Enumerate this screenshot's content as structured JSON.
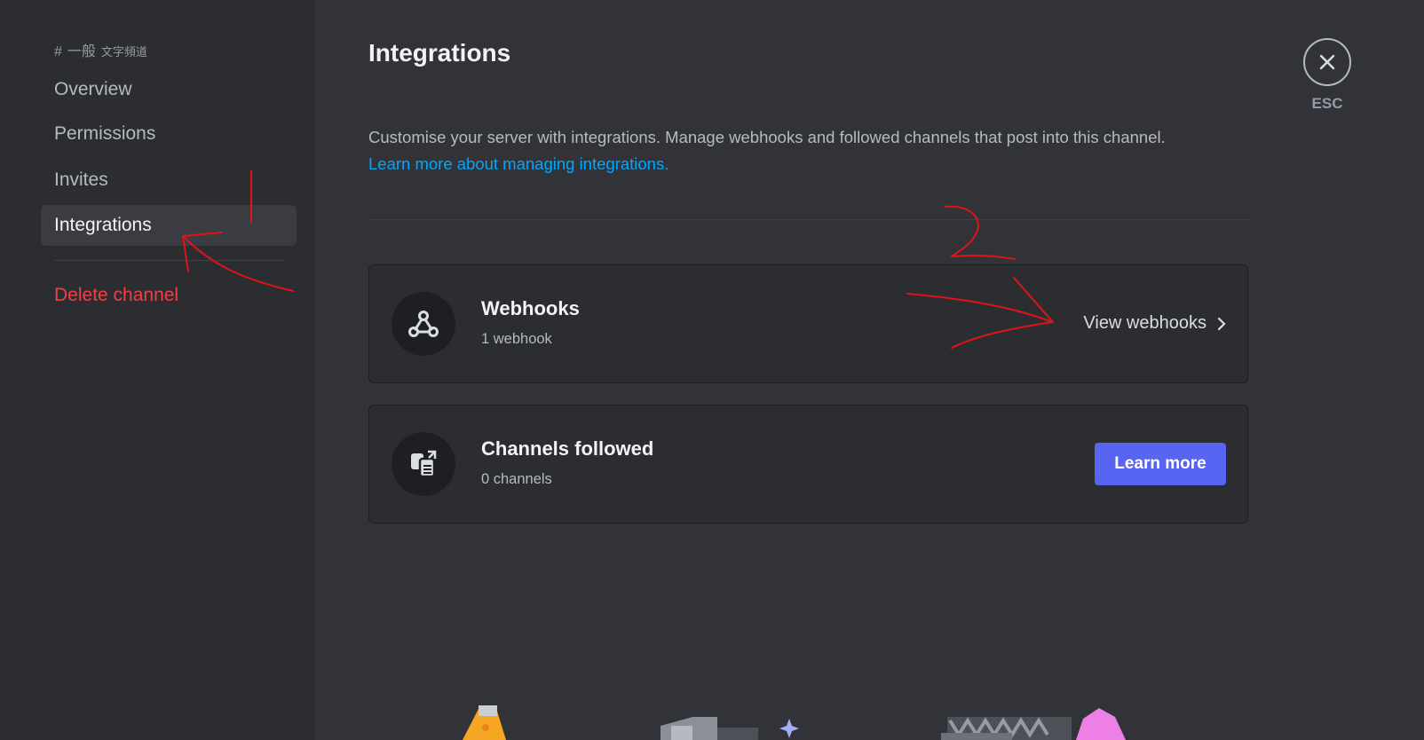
{
  "sidebar": {
    "channel_prefix": "#",
    "channel_name": "一般",
    "channel_type": "文字頻道",
    "items": [
      {
        "label": "Overview"
      },
      {
        "label": "Permissions"
      },
      {
        "label": "Invites"
      },
      {
        "label": "Integrations",
        "active": true
      }
    ],
    "delete_label": "Delete channel"
  },
  "main": {
    "title": "Integrations",
    "description": "Customise your server with integrations. Manage webhooks and followed channels that post into this channel.",
    "learn_more_link": "Learn more about managing integrations.",
    "webhooks": {
      "title": "Webhooks",
      "subtitle": "1 webhook",
      "action_label": "View webhooks",
      "icon": "webhook-icon"
    },
    "channels_followed": {
      "title": "Channels followed",
      "subtitle": "0 channels",
      "action_label": "Learn more",
      "icon": "channel-follow-icon"
    }
  },
  "close": {
    "esc_label": "ESC"
  },
  "annotations": {
    "label_1": "1",
    "label_2": "2",
    "color": "#e0131a"
  },
  "colors": {
    "accent": "#5865f2",
    "link": "#00a8fc",
    "danger": "#f23f43",
    "background": "#313338",
    "sidebar": "#2b2d31"
  }
}
